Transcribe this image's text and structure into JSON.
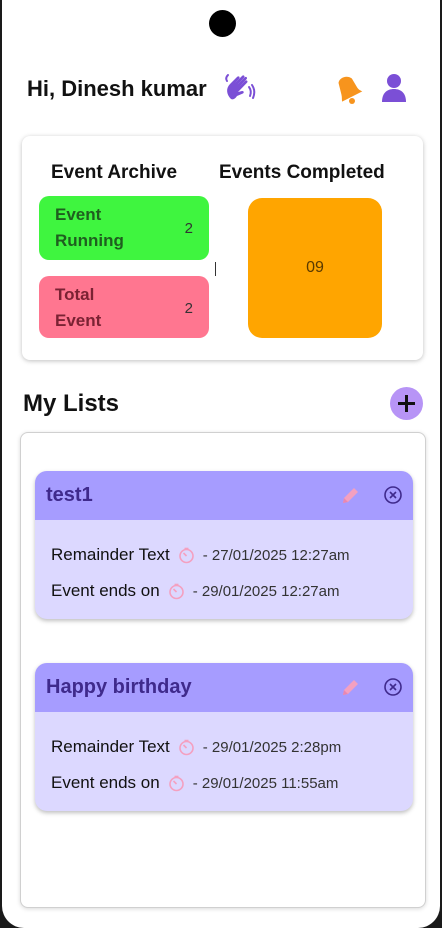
{
  "header": {
    "greeting": "Hi, Dinesh kumar"
  },
  "stats": {
    "archive_heading": "Event Archive",
    "completed_heading": "Events Completed",
    "running_label": "Event Running",
    "running_count": "2",
    "total_label": "Total Event",
    "total_count": "2",
    "completed_count": "09"
  },
  "lists": {
    "title": "My Lists",
    "events": [
      {
        "title": "test1",
        "reminder_label": "Remainder Text",
        "reminder_time": "- 27/01/2025 12:27am",
        "ends_label": "Event ends on",
        "ends_time": "- 29/01/2025 12:27am"
      },
      {
        "title": "Happy birthday",
        "reminder_label": "Remainder Text",
        "reminder_time": "- 29/01/2025 2:28pm",
        "ends_label": "Event ends on",
        "ends_time": "- 29/01/2025 11:55am"
      }
    ]
  },
  "colors": {
    "running": "#3ff53f",
    "total": "#ff7690",
    "completed": "#ffa500",
    "card_header": "#a69cff",
    "card_body": "#dcd8ff",
    "accent_purple": "#7b4fd6",
    "bell_orange": "#f7941d"
  }
}
